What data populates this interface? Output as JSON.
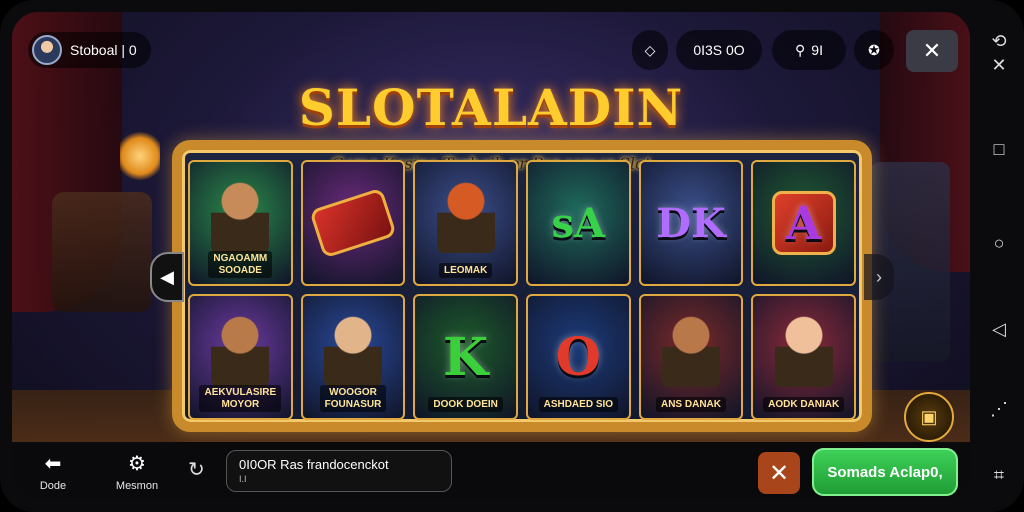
{
  "header": {
    "username": "Stoboal | 0",
    "balance": "0I3S 0O",
    "pill2_label": "9I",
    "icons": [
      "diamond-icon",
      "search-icon",
      "gamepad-icon",
      "close-icon"
    ]
  },
  "game": {
    "title": "SLOTALADIN",
    "subtitle": "Game Kasino Terbaik pr Pengemar Slot"
  },
  "reels": [
    {
      "label": "NGAOAMM\nSOOADE",
      "kind": "hero",
      "bg": "#2a8a4a",
      "skin": "#c78b5a"
    },
    {
      "label": "",
      "kind": "cannon",
      "bg": "#6b2a7a",
      "symbol": ""
    },
    {
      "label": "LEOMAK",
      "kind": "genie",
      "bg": "#3c4f8c",
      "skin": "#d65a24"
    },
    {
      "label": "",
      "kind": "letters",
      "bg": "#1f6b5c",
      "symbol": "sA",
      "color": "#38d24a"
    },
    {
      "label": "",
      "kind": "letters",
      "bg": "#3a4f8a",
      "symbol": "DK",
      "color": "#b06bff"
    },
    {
      "label": "",
      "kind": "cube",
      "bg": "#1f5a33",
      "symbol": "A",
      "color": "#a83adf"
    },
    {
      "label": "AEKVULASIRE\nMOYOR",
      "kind": "hero",
      "bg": "#6b3aa0",
      "skin": "#b97a4a"
    },
    {
      "label": "WOOGOR\nFOUNASUR",
      "kind": "hero",
      "bg": "#2a4a9a",
      "skin": "#e2b48a"
    },
    {
      "label": "DOOK DOEIN",
      "kind": "letters",
      "bg": "#1d5a2a",
      "symbol": "K",
      "color": "#3ccf3c"
    },
    {
      "label": "ASHDAED SIO",
      "kind": "letters",
      "bg": "#1c3b7a",
      "symbol": "O",
      "color": "#e23a2a"
    },
    {
      "label": "ANS DANAK",
      "kind": "hero",
      "bg": "#7a2a2a",
      "skin": "#b9784a"
    },
    {
      "label": "AODK DANIAK",
      "kind": "hero",
      "bg": "#8a2a3a",
      "skin": "#f0c09a"
    }
  ],
  "bottom_bar": {
    "back_label": "Dode",
    "menu_label": "Mesmon",
    "status_line1": "0I0OR Ras frandocenckot",
    "status_line2": "I.I",
    "play_label": "Somads Aclap0,"
  },
  "colors": {
    "accent_gold": "#ffcc2e",
    "play_green": "#2fb847",
    "cancel_orange": "#a9451a"
  }
}
